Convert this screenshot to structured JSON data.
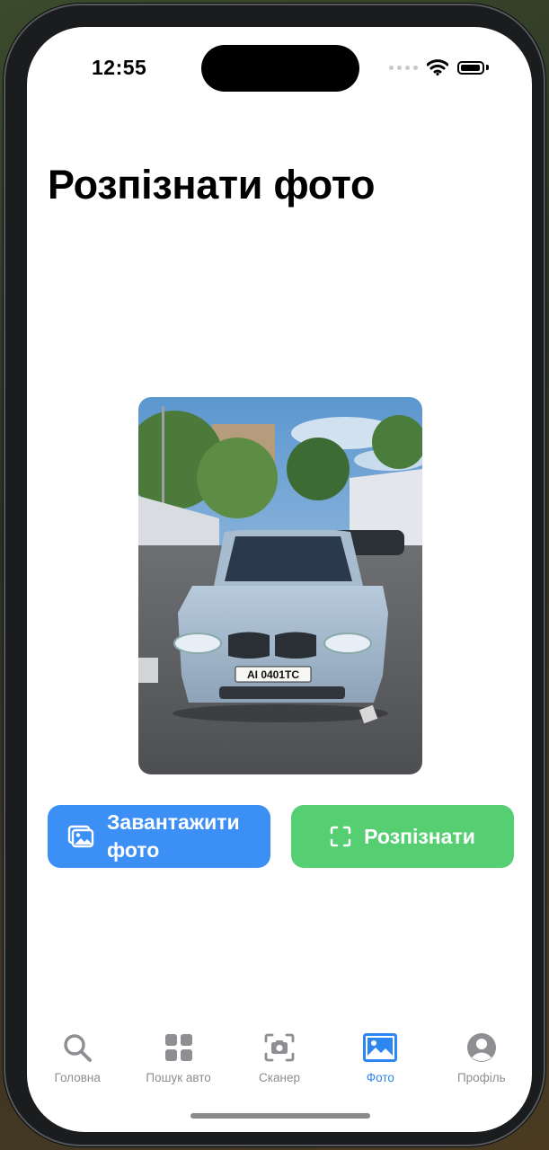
{
  "status": {
    "time": "12:55"
  },
  "page": {
    "title": "Розпізнати фото"
  },
  "photo": {
    "plate_text": "AI 0401TC"
  },
  "actions": {
    "upload_label": "Завантажити фото",
    "recognize_label": "Розпізнати"
  },
  "tabs": [
    {
      "label": "Головна",
      "icon": "search-icon",
      "active": false
    },
    {
      "label": "Пошук авто",
      "icon": "grid-icon",
      "active": false
    },
    {
      "label": "Сканер",
      "icon": "camera-scan-icon",
      "active": false
    },
    {
      "label": "Фото",
      "icon": "photo-icon",
      "active": true
    },
    {
      "label": "Профіль",
      "icon": "profile-icon",
      "active": false
    }
  ],
  "colors": {
    "upload_button": "#3b8ff5",
    "recognize_button": "#55cf72",
    "active_tab": "#2e86f0",
    "inactive_tab": "#8e8e93"
  }
}
